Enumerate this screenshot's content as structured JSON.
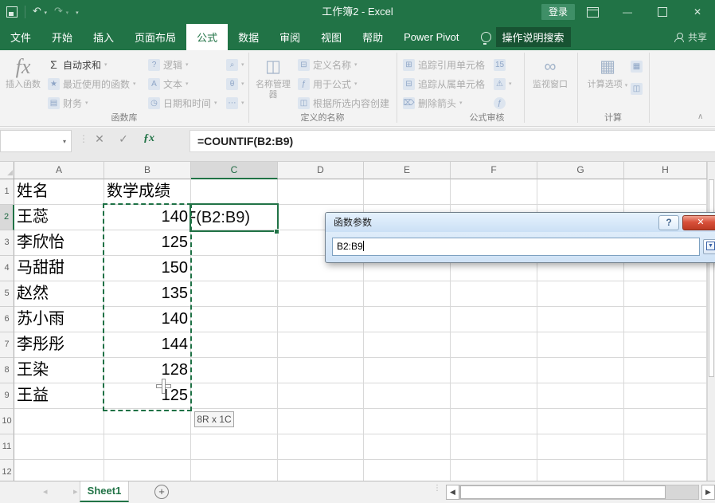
{
  "colors": {
    "accent": "#217346",
    "ants_green": "#1e7145",
    "dialog_close_red": "#c03821"
  },
  "titlebar": {
    "title": "工作簿2 - Excel",
    "login": "登录"
  },
  "icons": {
    "undo": "↶",
    "redo": "↷",
    "dropdown": "▾",
    "minimize": "—",
    "close": "✕",
    "namebox_dropdown": "▾",
    "dots": "⋮",
    "cancel": "✕",
    "enter": "✓",
    "fx": "ƒx",
    "fx_big": "fx",
    "autosum": "Σ",
    "recent": "★",
    "financial": "▤",
    "logical": "?",
    "text": "A",
    "datetime": "◷",
    "lookup": "⌕",
    "math_trig": "θ",
    "more_functions": "⋯",
    "name_manager": "◫",
    "define_name": "⊟",
    "use_in_formula": "ƒ",
    "create_from_selection": "◫",
    "trace_precedents": "⊞",
    "trace_dependents": "⊟",
    "remove_arrows": "⌦",
    "show_formulas": "15",
    "error_checking": "⚠",
    "evaluate_formula": "ƒ",
    "watch_window": "∞",
    "calc_options": "▦",
    "calc_now": "▦",
    "calc_sheet": "◫",
    "collapse_ribbon": "∧",
    "select_all": "◢",
    "sheet_prev": "◂",
    "sheet_next": "▸",
    "add_sheet": "+",
    "hscroll_left": "◀",
    "hscroll_right": "▶",
    "dialog_help": "?",
    "dialog_close": "✕",
    "range_collapse": "▼"
  },
  "tabs": {
    "items": [
      {
        "id": "file",
        "label": "文件",
        "active": false
      },
      {
        "id": "home",
        "label": "开始",
        "active": false
      },
      {
        "id": "insert",
        "label": "插入",
        "active": false
      },
      {
        "id": "page-layout",
        "label": "页面布局",
        "active": false
      },
      {
        "id": "formulas",
        "label": "公式",
        "active": true
      },
      {
        "id": "data",
        "label": "数据",
        "active": false
      },
      {
        "id": "review",
        "label": "审阅",
        "active": false
      },
      {
        "id": "view",
        "label": "视图",
        "active": false
      },
      {
        "id": "help",
        "label": "帮助",
        "active": false
      },
      {
        "id": "power-pivot",
        "label": "Power Pivot",
        "active": false
      }
    ]
  },
  "search": {
    "label": "操作说明搜索"
  },
  "share": {
    "label": "共享"
  },
  "ribbon": {
    "insert_function": "插入函数",
    "autosum": "自动求和",
    "recent": "最近使用的函数",
    "financial": "财务",
    "logical": "逻辑",
    "text": "文本",
    "datetime": "日期和时间",
    "name_manager": "名称管理器",
    "define_name": "定义名称",
    "use_in_formula": "用于公式",
    "create_from_selection": "根据所选内容创建",
    "trace_precedents": "追踪引用单元格",
    "trace_dependents": "追踪从属单元格",
    "remove_arrows": "删除箭头",
    "watch_window": "监视窗口",
    "calc_options": "计算选项",
    "labels": {
      "function_library": "函数库",
      "defined_names": "定义的名称",
      "formula_auditing": "公式审核",
      "calculation": "计算"
    }
  },
  "formula_bar": {
    "formula": "=COUNTIF(B2:B9)"
  },
  "grid": {
    "col_headers": [
      "A",
      "B",
      "C",
      "D",
      "E",
      "F",
      "G",
      "H"
    ],
    "active_col": "C",
    "row_headers": [
      "1",
      "2",
      "3",
      "4",
      "5",
      "6",
      "7",
      "8",
      "9",
      "10",
      "11",
      "12"
    ],
    "active_row": "2",
    "col_a": [
      "姓名",
      "王蕊",
      "李欣怡",
      "马甜甜",
      "赵然",
      "苏小雨",
      "李彤彤",
      "王染",
      "王益"
    ],
    "col_b": [
      "数学成绩",
      "140",
      "125",
      "150",
      "135",
      "140",
      "144",
      "128",
      "125"
    ],
    "c2_visible_text": "F(B2:B9)",
    "selection_tooltip": "8R x 1C"
  },
  "dialog": {
    "title": "函数参数",
    "range_value": "B2:B9"
  },
  "sheetbar": {
    "sheet_name": "Sheet1"
  }
}
